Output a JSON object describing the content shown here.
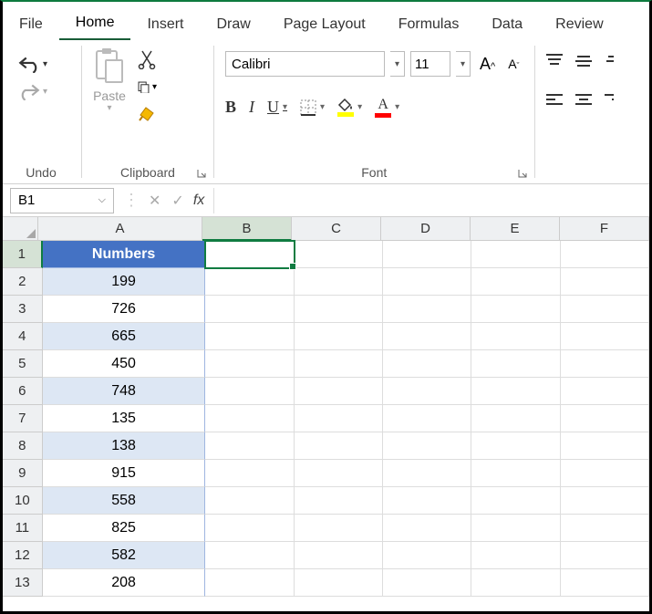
{
  "ribbon": {
    "tabs": [
      "File",
      "Home",
      "Insert",
      "Draw",
      "Page Layout",
      "Formulas",
      "Data",
      "Review"
    ],
    "active_tab": "Home",
    "groups": {
      "undo": {
        "label": "Undo"
      },
      "clipboard": {
        "label": "Clipboard",
        "paste_label": "Paste"
      },
      "font": {
        "label": "Font",
        "name": "Calibri",
        "size": "11"
      },
      "alignment": {
        "label": ""
      }
    }
  },
  "namebox": {
    "value": "B1"
  },
  "formula_bar": {
    "value": "",
    "fx_label": "fx"
  },
  "columns": [
    "A",
    "B",
    "C",
    "D",
    "E",
    "F"
  ],
  "selected_cell": "B1",
  "table": {
    "header": "Numbers",
    "rows": [
      {
        "n": "1",
        "v": "Numbers"
      },
      {
        "n": "2",
        "v": "199"
      },
      {
        "n": "3",
        "v": "726"
      },
      {
        "n": "4",
        "v": "665"
      },
      {
        "n": "5",
        "v": "450"
      },
      {
        "n": "6",
        "v": "748"
      },
      {
        "n": "7",
        "v": "135"
      },
      {
        "n": "8",
        "v": "138"
      },
      {
        "n": "9",
        "v": "915"
      },
      {
        "n": "10",
        "v": "558"
      },
      {
        "n": "11",
        "v": "825"
      },
      {
        "n": "12",
        "v": "582"
      },
      {
        "n": "13",
        "v": "208"
      }
    ]
  }
}
